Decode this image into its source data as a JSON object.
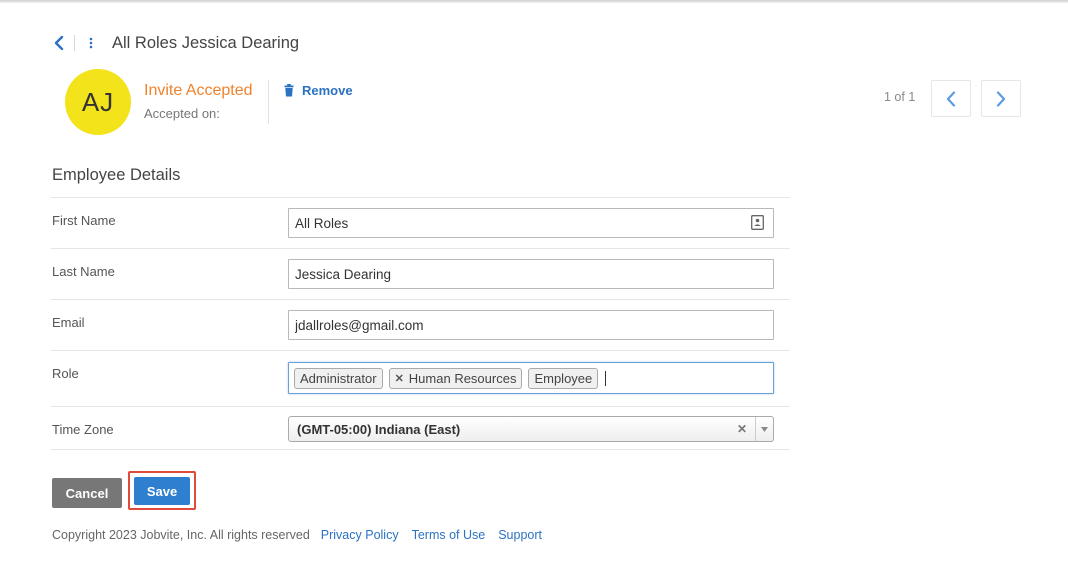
{
  "header": {
    "title": "All Roles Jessica Dearing"
  },
  "profile": {
    "initials": "AJ",
    "status": "Invite Accepted",
    "accepted_on_label": "Accepted on:",
    "remove_label": "Remove"
  },
  "pager": {
    "text": "1 of 1"
  },
  "form": {
    "section_title": "Employee Details",
    "first_name": {
      "label": "First Name",
      "value": "All Roles"
    },
    "last_name": {
      "label": "Last Name",
      "value": "Jessica Dearing"
    },
    "email": {
      "label": "Email",
      "value": "jdallroles@gmail.com"
    },
    "role": {
      "label": "Role",
      "tags": [
        {
          "text": "Administrator",
          "removable": false
        },
        {
          "text": "Human Resources",
          "removable": true
        },
        {
          "text": "Employee",
          "removable": false
        }
      ]
    },
    "time_zone": {
      "label": "Time Zone",
      "value": "(GMT-05:00) Indiana (East)"
    }
  },
  "actions": {
    "cancel_label": "Cancel",
    "save_label": "Save"
  },
  "footer": {
    "copyright": "Copyright 2023 Jobvite, Inc. All rights reserved",
    "privacy": "Privacy Policy",
    "terms": "Terms of Use",
    "support": "Support"
  },
  "colors": {
    "accent": "#2b72c2",
    "status": "#f0822d",
    "avatar_bg": "#f2e31a",
    "save": "#2f7fd1",
    "cancel": "#777777",
    "highlight": "#e04a3a"
  },
  "icons": [
    "chevron-left-icon",
    "kebab-menu-icon",
    "trash-icon",
    "chevron-right-icon",
    "contact-card-icon",
    "clear-icon",
    "dropdown-arrow-icon"
  ]
}
